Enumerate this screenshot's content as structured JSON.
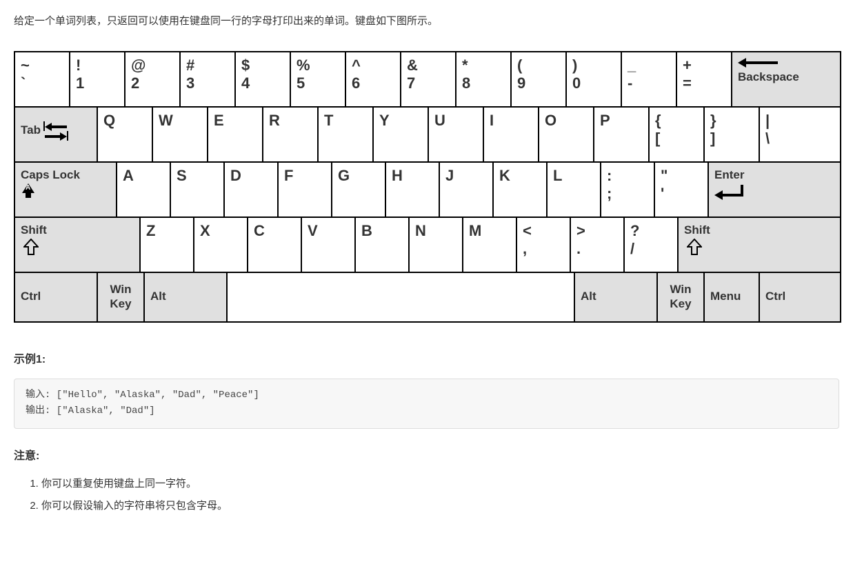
{
  "description": "给定一个单词列表，只返回可以使用在键盘同一行的字母打印出来的单词。键盘如下图所示。",
  "keyboard": {
    "row1": [
      {
        "top": "~",
        "bot": "`"
      },
      {
        "top": "!",
        "bot": "1"
      },
      {
        "top": "@",
        "bot": "2"
      },
      {
        "top": "#",
        "bot": "3"
      },
      {
        "top": "$",
        "bot": "4"
      },
      {
        "top": "%",
        "bot": "5"
      },
      {
        "top": "^",
        "bot": "6"
      },
      {
        "top": "&",
        "bot": "7"
      },
      {
        "top": "*",
        "bot": "8"
      },
      {
        "top": "(",
        "bot": "9"
      },
      {
        "top": ")",
        "bot": "0"
      },
      {
        "top": "_",
        "bot": "-"
      },
      {
        "top": "+",
        "bot": "="
      }
    ],
    "backspace": "Backspace",
    "tab": "Tab",
    "row2": [
      "Q",
      "W",
      "E",
      "R",
      "T",
      "Y",
      "U",
      "I",
      "O",
      "P"
    ],
    "row2_sym": [
      {
        "top": "{",
        "bot": "["
      },
      {
        "top": "}",
        "bot": "]"
      },
      {
        "top": "|",
        "bot": "\\"
      }
    ],
    "caps": "Caps Lock",
    "row3": [
      "A",
      "S",
      "D",
      "F",
      "G",
      "H",
      "J",
      "K",
      "L"
    ],
    "row3_sym": [
      {
        "top": ":",
        "bot": ";"
      },
      {
        "top": "\"",
        "bot": "'"
      }
    ],
    "enter": "Enter",
    "shift": "Shift",
    "row4": [
      "Z",
      "X",
      "C",
      "V",
      "B",
      "N",
      "M"
    ],
    "row4_sym": [
      {
        "top": "<",
        "bot": ","
      },
      {
        "top": ">",
        "bot": "."
      },
      {
        "top": "?",
        "bot": "/"
      }
    ],
    "row5": {
      "ctrl": "Ctrl",
      "win": "Win",
      "key": "Key",
      "alt": "Alt",
      "menu": "Menu"
    }
  },
  "example_heading": "示例1:",
  "example_input_label": "输入:",
  "example_input_value": " [\"Hello\", \"Alaska\", \"Dad\", \"Peace\"]",
  "example_output_label": "输出:",
  "example_output_value": " [\"Alaska\", \"Dad\"]",
  "notes_heading": "注意:",
  "notes": [
    "你可以重复使用键盘上同一字符。",
    "你可以假设输入的字符串将只包含字母。"
  ]
}
